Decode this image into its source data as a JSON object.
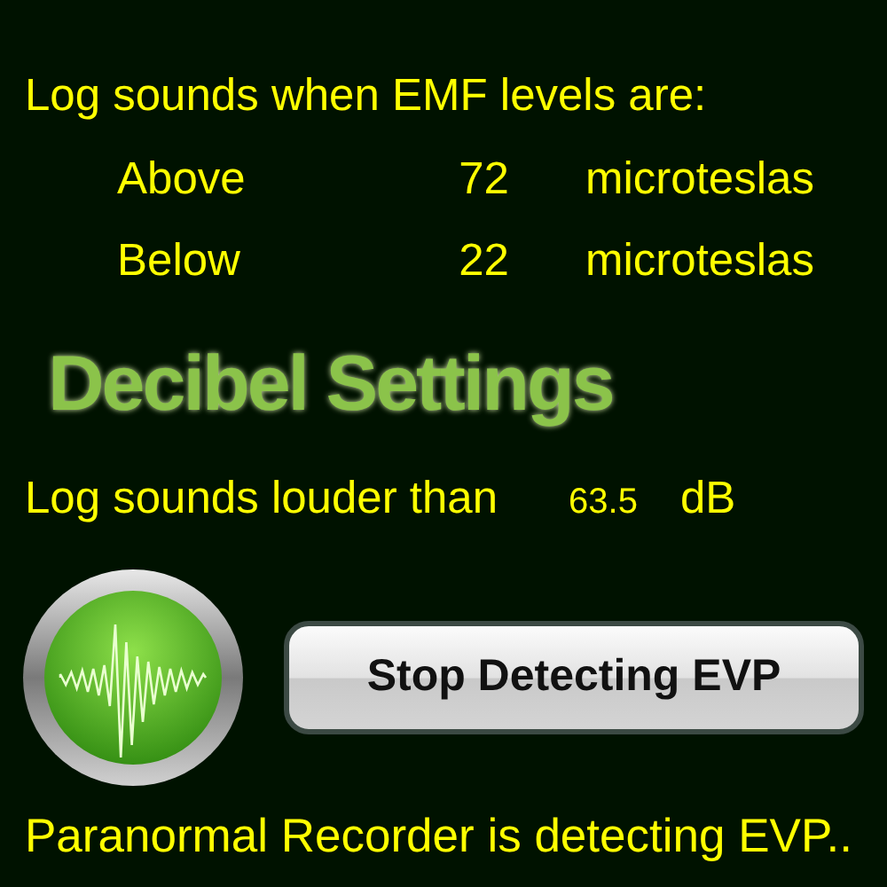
{
  "emf_settings": {
    "prompt": "Log sounds when EMF levels are:",
    "thresholds": [
      {
        "label": "Above",
        "value": "72",
        "unit": "microteslas"
      },
      {
        "label": "Below",
        "value": "22",
        "unit": "microteslas"
      }
    ]
  },
  "decibel_settings": {
    "title": "Decibel Settings",
    "label": "Log sounds louder than",
    "value": "63.5",
    "unit": "dB"
  },
  "detect_button": "Stop Detecting EVP",
  "status": "Paranormal Recorder is detecting EVP.."
}
